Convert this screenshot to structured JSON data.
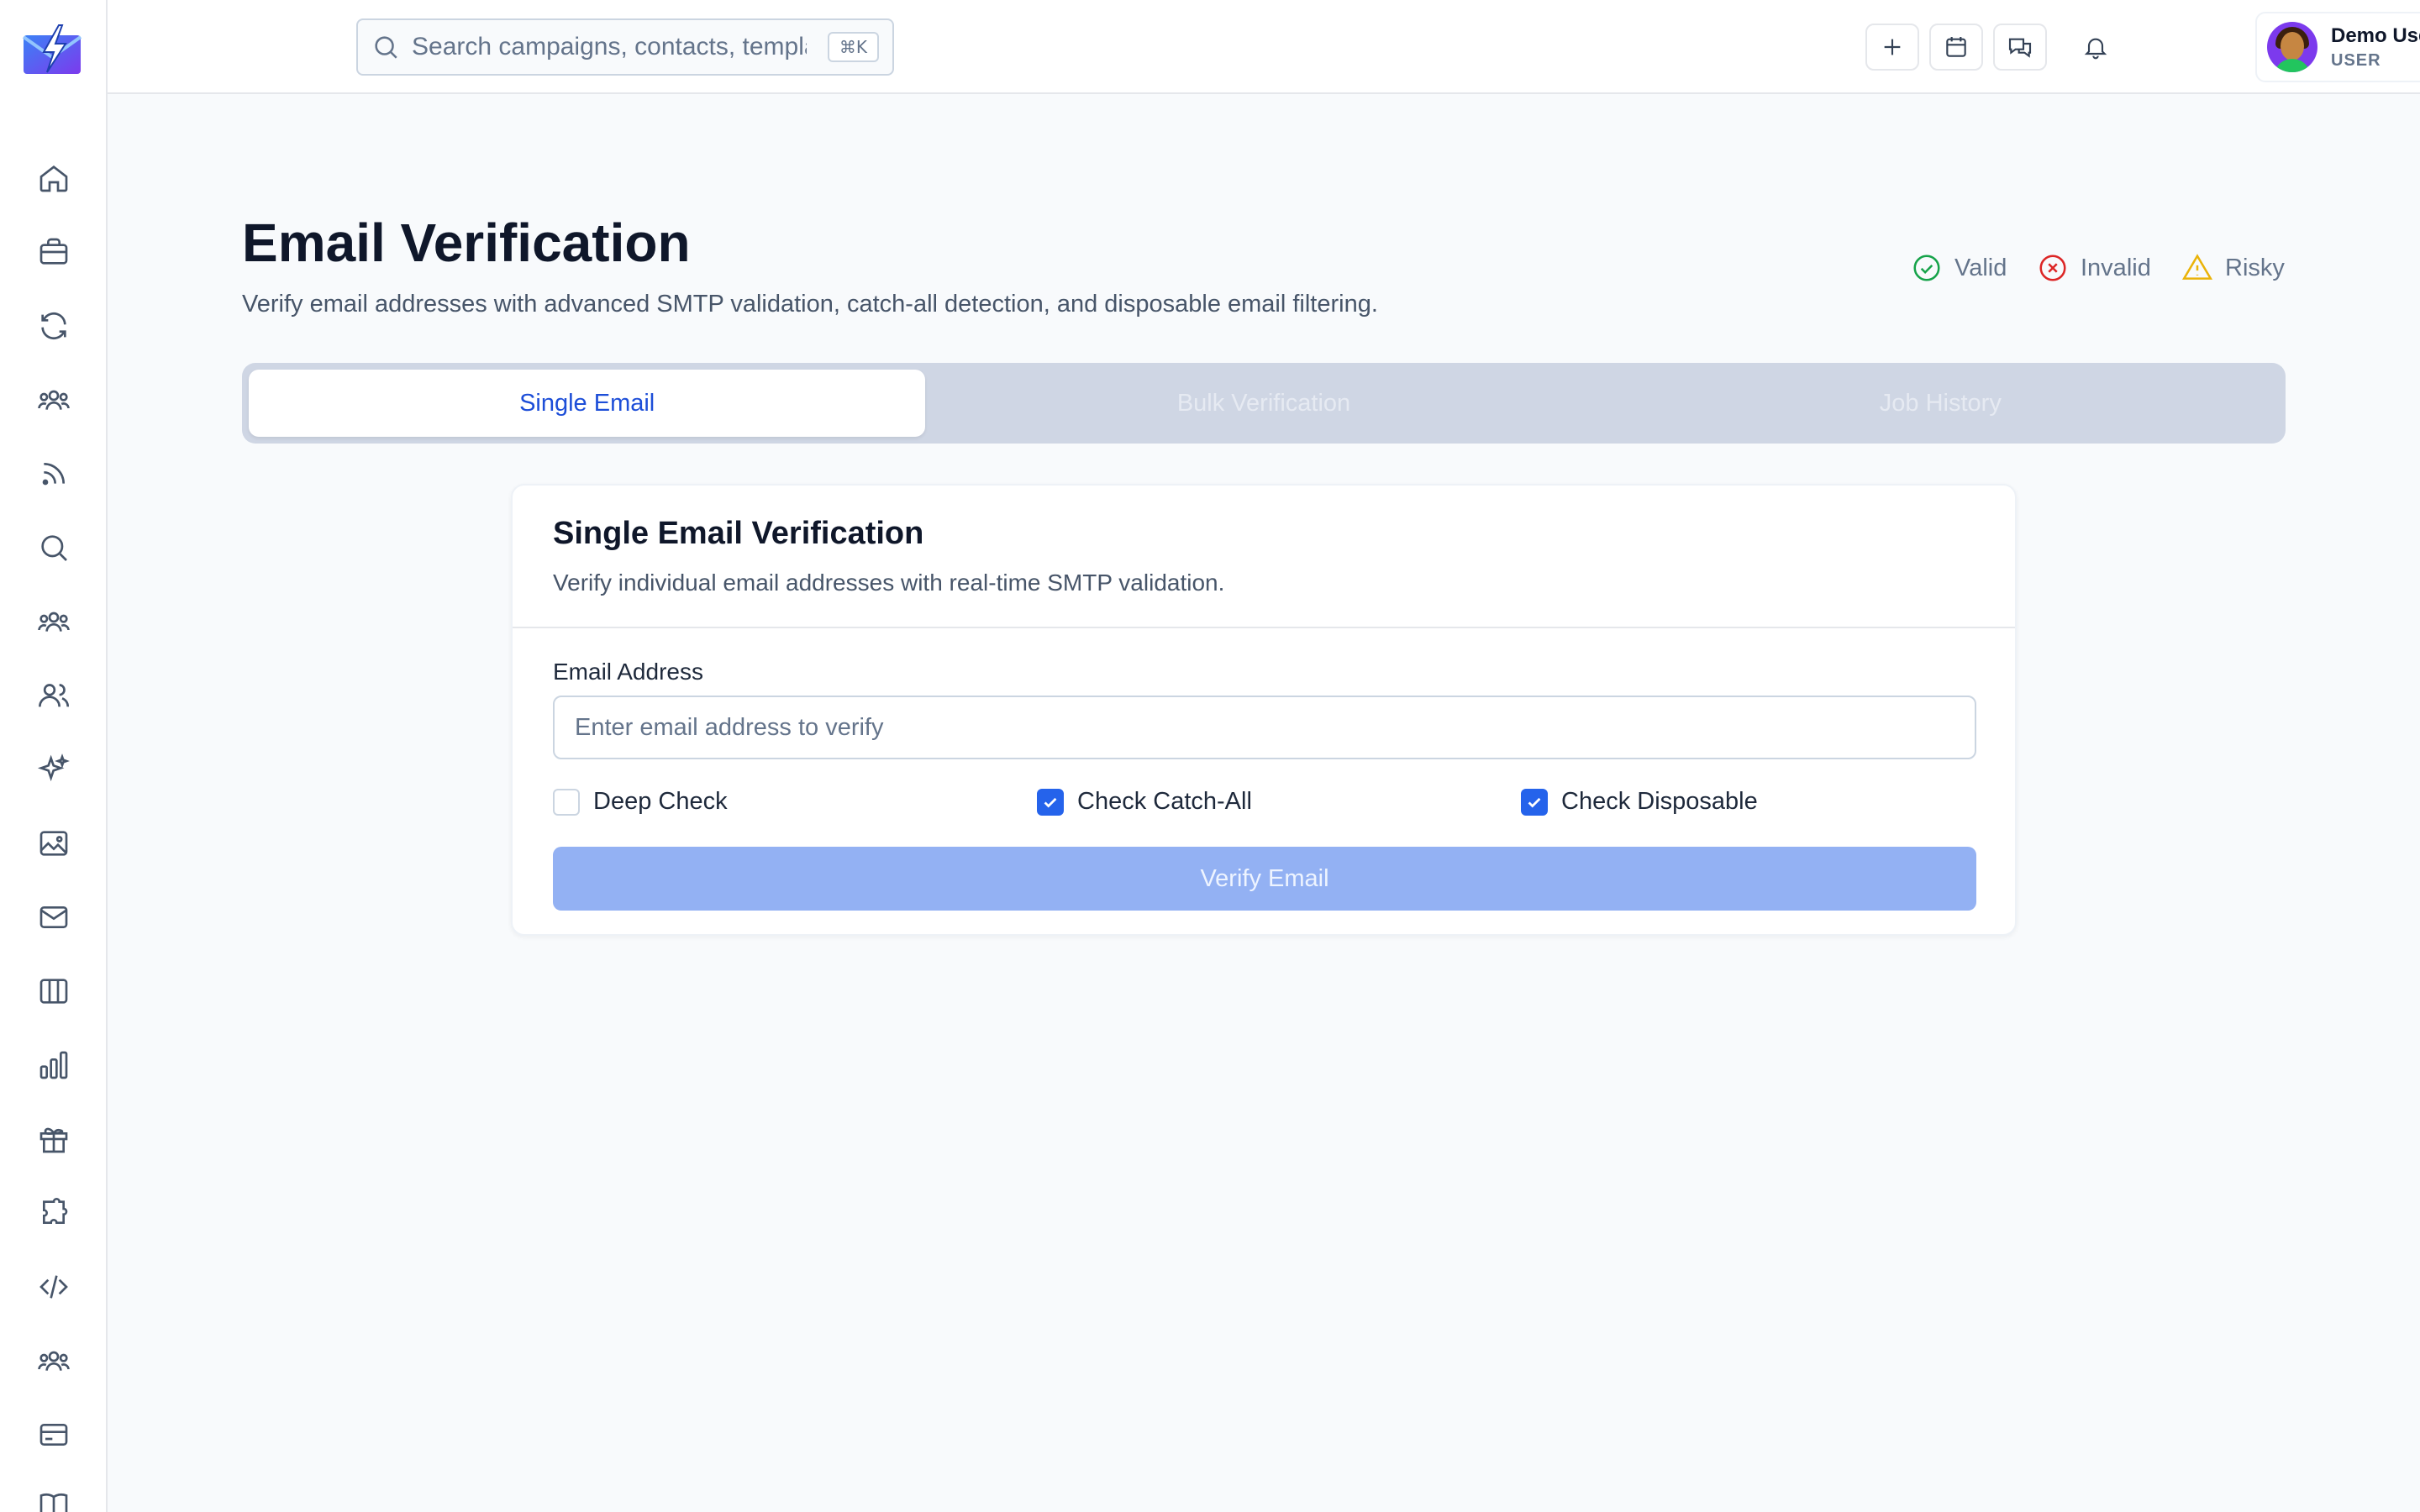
{
  "search": {
    "placeholder": "Search campaigns, contacts, templates...",
    "shortcut": "⌘K"
  },
  "user": {
    "name": "Demo User",
    "role": "USER"
  },
  "page": {
    "title": "Email Verification",
    "subtitle": "Verify email addresses with advanced SMTP validation, catch-all detection, and disposable email filtering."
  },
  "legend": {
    "valid": "Valid",
    "invalid": "Invalid",
    "risky": "Risky"
  },
  "tabs": [
    {
      "label": "Single Email",
      "active": true
    },
    {
      "label": "Bulk Verification",
      "active": false
    },
    {
      "label": "Job History",
      "active": false
    }
  ],
  "card": {
    "title": "Single Email Verification",
    "description": "Verify individual email addresses with real-time SMTP validation.",
    "email_label": "Email Address",
    "email_placeholder": "Enter email address to verify",
    "email_value": "",
    "options": [
      {
        "label": "Deep Check",
        "checked": false
      },
      {
        "label": "Check Catch-All",
        "checked": true
      },
      {
        "label": "Check Disposable",
        "checked": true
      }
    ],
    "verify_label": "Verify Email"
  },
  "colors": {
    "accent": "#2563eb",
    "valid": "#16a34a",
    "invalid": "#dc2626",
    "risky": "#eab308",
    "button_disabled": "#93b1f3"
  },
  "icons": {
    "sidebar": [
      "home-icon",
      "briefcase-icon",
      "refresh-icon",
      "users-group-icon",
      "rss-icon",
      "search-icon",
      "users-group-icon",
      "users-icon",
      "sparkles-icon",
      "image-icon",
      "mail-icon",
      "columns-icon",
      "bar-chart-icon",
      "gift-icon",
      "puzzle-icon",
      "code-icon",
      "users-group-icon",
      "credit-card-icon",
      "book-icon"
    ]
  }
}
